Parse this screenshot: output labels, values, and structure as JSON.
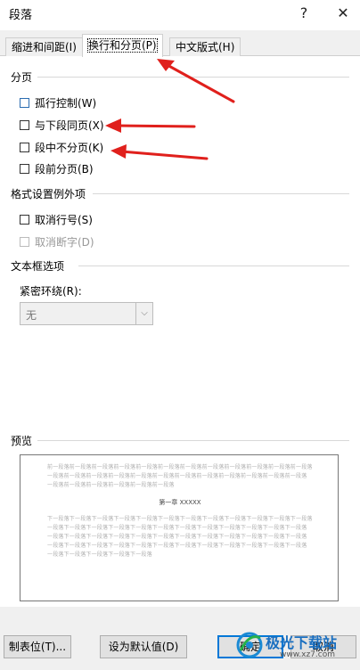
{
  "window": {
    "title": "段落",
    "help": "?",
    "close": "✕"
  },
  "tabs": [
    {
      "label": "缩进和间距(I)"
    },
    {
      "label": "换行和分页(P)"
    },
    {
      "label": "中文版式(H)"
    }
  ],
  "pagination": {
    "group_label": "分页",
    "items": [
      {
        "label": "孤行控制(W)",
        "checked": false
      },
      {
        "label": "与下段同页(X)",
        "checked": false
      },
      {
        "label": "段中不分页(K)",
        "checked": false
      },
      {
        "label": "段前分页(B)",
        "checked": false
      }
    ]
  },
  "exceptions": {
    "group_label": "格式设置例外项",
    "items": [
      {
        "label": "取消行号(S)",
        "checked": false,
        "disabled": false
      },
      {
        "label": "取消断字(D)",
        "checked": false,
        "disabled": true
      }
    ]
  },
  "textbox": {
    "group_label": "文本框选项",
    "wrap_label": "紧密环绕(R):",
    "wrap_value": "无"
  },
  "preview": {
    "group_label": "预览",
    "prev_lines": [
      "前一段落前一段落前一段落前一段落前一段落前一段落前一段落前一段落前一段落前一段落前一段落前一段落",
      "一段落前一段落前一段落前一段落前一段落前一段落前一段落前一段落前一段落前一段落前一段落前一段落",
      "一段落前一段落前一段落前一段落前一段落前一段落"
    ],
    "heading": "第一章 XXXXX",
    "next_lines": [
      "下一段落下一段落下一段落下一段落下一段落下一段落下一段落下一段落下一段落下一段落下一段落下一段落",
      "一段落下一段落下一段落下一段落下一段落下一段落下一段落下一段落下一段落下一段落下一段落下一段落",
      "一段落下一段落下一段落下一段落下一段落下一段落下一段落下一段落下一段落下一段落下一段落下一段落",
      "一段落下一段落下一段落下一段落下一段落下一段落下一段落下一段落下一段落下一段落下一段落下一段落",
      "一段落下一段落下一段落下一段落下一段落"
    ]
  },
  "buttons": {
    "tabs": "制表位(T)...",
    "set_default": "设为默认值(D)",
    "ok": "确定",
    "cancel": "取消"
  },
  "watermark": {
    "text": "极光下载站",
    "url": "www.xz7.com"
  },
  "colors": {
    "accent": "#0078d7",
    "annotation_arrow": "#e0201c"
  }
}
